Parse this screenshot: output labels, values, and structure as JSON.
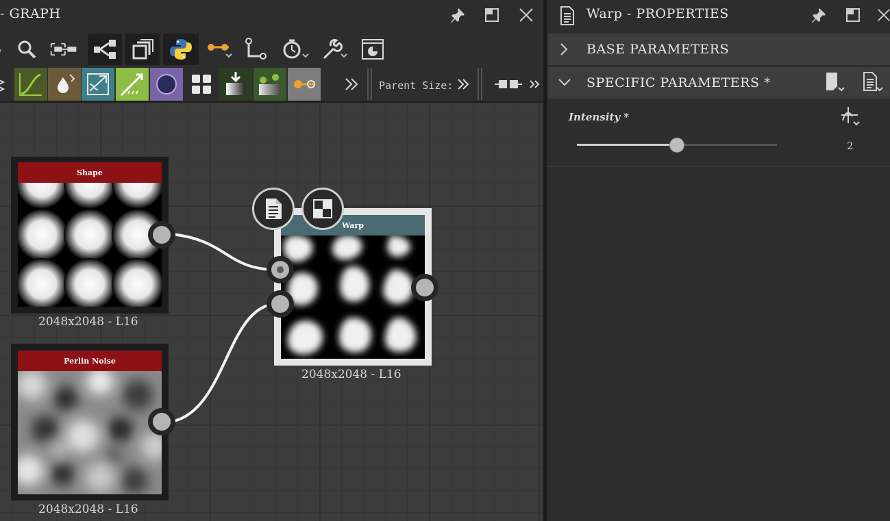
{
  "graph": {
    "title": "- GRAPH",
    "parent_size_label": "Parent Size:",
    "nodes": [
      {
        "title": "Shape",
        "caption": "2048x2048 - L16",
        "header_color": "#8e1116"
      },
      {
        "title": "Perlin Noise",
        "caption": "2048x2048 - L16",
        "header_color": "#8e1116"
      },
      {
        "title": "Warp",
        "caption": "2048x2048 - L16",
        "header_color": "#4a6b73"
      }
    ]
  },
  "properties": {
    "title": "Warp - PROPERTIES",
    "sections": [
      {
        "label": "BASE PARAMETERS",
        "expanded": false
      },
      {
        "label": "SPECIFIC PARAMETERS *",
        "expanded": true
      }
    ],
    "parameter": {
      "label": "Intensity *",
      "value": "2",
      "fraction": 0.5
    }
  },
  "colors": {
    "accent_orange": "#f0a030",
    "python_blue": "#3b73b4",
    "python_yellow": "#f4cf3e"
  }
}
